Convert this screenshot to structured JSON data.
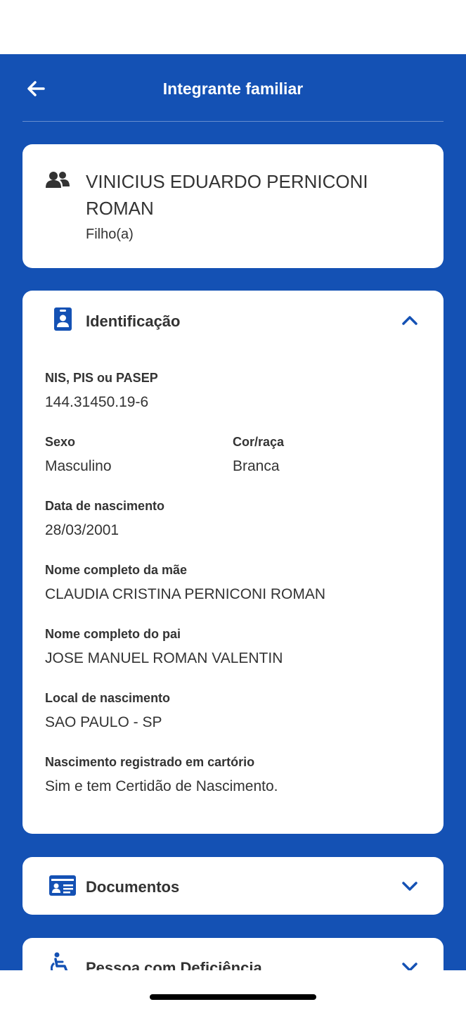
{
  "header": {
    "title": "Integrante familiar"
  },
  "person": {
    "name": "VINICIUS EDUARDO PERNICONI ROMAN",
    "relationship": "Filho(a)"
  },
  "identification": {
    "title": "Identificação",
    "nis_label": "NIS, PIS ou PASEP",
    "nis_value": "144.31450.19-6",
    "sexo_label": "Sexo",
    "sexo_value": "Masculino",
    "cor_label": "Cor/raça",
    "cor_value": "Branca",
    "nasc_label": "Data de nascimento",
    "nasc_value": "28/03/2001",
    "mae_label": "Nome completo da mãe",
    "mae_value": "CLAUDIA CRISTINA PERNICONI ROMAN",
    "pai_label": "Nome completo do pai",
    "pai_value": "JOSE MANUEL ROMAN VALENTIN",
    "local_label": "Local de nascimento",
    "local_value": "SAO PAULO - SP",
    "cartorio_label": "Nascimento registrado em cartório",
    "cartorio_value": "Sim e tem Certidão de Nascimento."
  },
  "documents": {
    "title": "Documentos"
  },
  "disability": {
    "title": "Pessoa com Deficiência"
  },
  "colors": {
    "brand_blue": "#1451b4",
    "text": "#333333",
    "card": "#ffffff"
  }
}
